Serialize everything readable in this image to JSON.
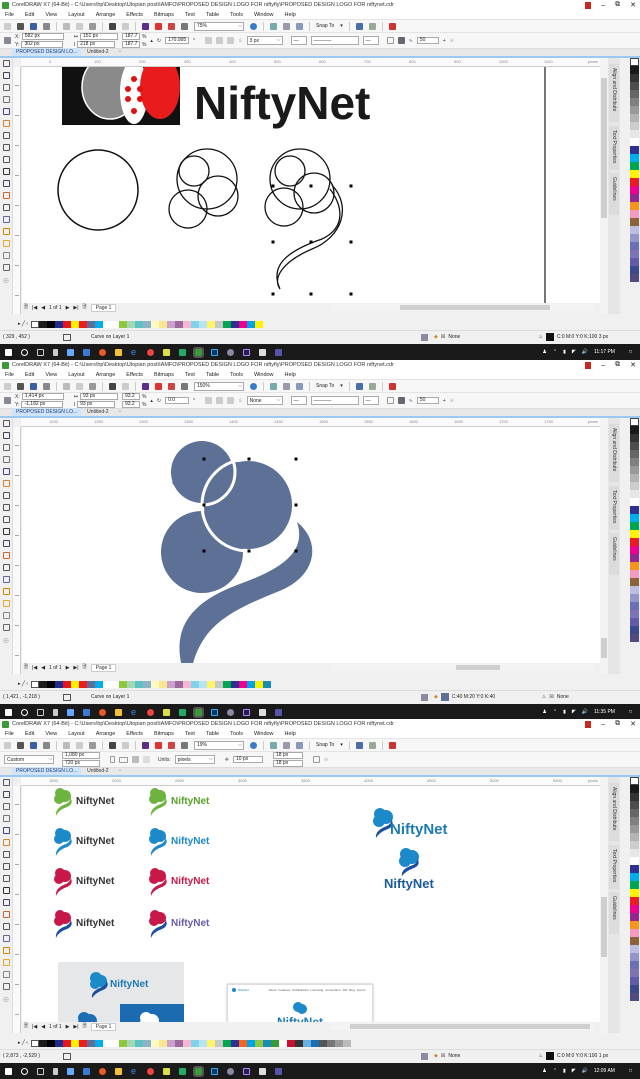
{
  "window": {
    "title": "CorelDRAW X7 (64-Bit) - C:\\Users\\hp\\Desktop\\Utopian post\\IAMFO\\PROPOSED DESIGN LOGO FOR niftyfly\\PROPOSED DESIGN LOGO FOR niftynet.cdr"
  },
  "menu": [
    "File",
    "Edit",
    "View",
    "Layout",
    "Arrange",
    "Effects",
    "Bitmaps",
    "Text",
    "Table",
    "Tools",
    "Window",
    "Help"
  ],
  "tabs": [
    {
      "label": "PROPOSED DESIGN LO..."
    },
    {
      "label": "Untitled-2"
    },
    {
      "label": "+"
    }
  ],
  "snap_label": "Snap To",
  "ruler_units": "pixels",
  "page_nav": {
    "counter": "1 of 1",
    "page_tab": "Page 1"
  },
  "palette_colors": [
    "#1a1a1a",
    "#333333",
    "#4d4d4d",
    "#666666",
    "#808080",
    "#999999",
    "#b3b3b3",
    "#cccccc",
    "#e6e6e6",
    "#ffffff",
    "#2e3192",
    "#00aeef",
    "#00a651",
    "#fff200",
    "#ed1c24",
    "#ec008c",
    "#92278f",
    "#f7941d",
    "#f49ac1",
    "#8c6239",
    "#bcbde0",
    "#9595c9",
    "#6d6fb5",
    "#7d73b5",
    "#605ca8",
    "#3a4a8a",
    "#514c80"
  ],
  "doc_palette": {
    "screen1": [
      "#1a1a1a",
      "#000000",
      "#1d2c8f",
      "#e8141e",
      "#fff200",
      "#ed1c24",
      "#5d7095",
      "#00aeef",
      "#ffffff",
      "#ffffff",
      "#8dc63f",
      "#a4d6b5",
      "#5bc4c1",
      "#8eb3c8",
      "#fff9c4",
      "#fbe58e",
      "#c7a0cb",
      "#9e6a9e",
      "#f7b6d2",
      "#7fd3e8",
      "#b8e3f4",
      "#fff568",
      "#c8c8c8",
      "#00a651",
      "#2e3192",
      "#ec008c",
      "#00a2e8",
      "#fff200"
    ],
    "screen2": [
      "#1a1a1a",
      "#000000",
      "#1d2c8f",
      "#e8141e",
      "#fff200",
      "#ed1c24",
      "#5d7095",
      "#00aeef",
      "#ffffff",
      "#ffffff",
      "#8dc63f",
      "#a4d6b5",
      "#5bc4c1",
      "#8eb3c8",
      "#fff9c4",
      "#fbe58e",
      "#c7a0cb",
      "#9e6a9e",
      "#f7b6d2",
      "#7fd3e8",
      "#b8e3f4",
      "#fff568",
      "#c8c8c8",
      "#00a651",
      "#2e3192",
      "#ec008c",
      "#00a2e8",
      "#fff200",
      "#1b8bb5"
    ],
    "screen3": [
      "#1a1a1a",
      "#000000",
      "#1d2c8f",
      "#e8141e",
      "#fff200",
      "#ed1c24",
      "#5d7095",
      "#00aeef",
      "#ffffff",
      "#ffffff",
      "#8dc63f",
      "#a4d6b5",
      "#5bc4c1",
      "#8eb3c8",
      "#fff9c4",
      "#fbe58e",
      "#c7a0cb",
      "#9e6a9e",
      "#f7b6d2",
      "#7fd3e8",
      "#b8e3f4",
      "#fff568",
      "#c8c8c8",
      "#00a651",
      "#2e3192",
      "#f26522",
      "#00a2e8",
      "#8dc63f",
      "#1b8bb5",
      "#3a9a3a",
      "#ffffff",
      "#c8102e",
      "#333333",
      "#6ab0de",
      "#1b6fb5",
      "#555555",
      "#777777",
      "#999999",
      "#bbbbbb"
    ]
  },
  "dockers": [
    "Align and Distribute",
    "Text Properties",
    "Guidelines"
  ],
  "screens": [
    {
      "zoom": "75%",
      "x": "582 px",
      "y": "302 px",
      "w": "151 px",
      "h": "218 px",
      "sx": "187.7",
      "sy": "187.7",
      "pct": "%",
      "angle": "170.995",
      "outline_width": "3 px",
      "smooth": "50",
      "ruler_ticks": [
        "0",
        "100",
        "200",
        "300",
        "400",
        "500",
        "600",
        "700",
        "800",
        "900",
        "1000",
        "1100"
      ],
      "status_coords": "( 329 , 452 )",
      "status_object": "Curve on Layer 1",
      "fill_label": "None",
      "outline_label": "C:0 M:0 Y:0 K:100  3 px",
      "clock": "11:17 PM",
      "canvas": {
        "logo_text": "NiftyNet"
      }
    },
    {
      "zoom": "150%",
      "x": "1,414 px",
      "y": "-1,182 px",
      "w": "93 px",
      "h": "93 px",
      "sx": "93.2",
      "sy": "93.2",
      "pct": "%",
      "angle": "0.0",
      "outline_width": "None",
      "smooth": "50",
      "ruler_ticks": [
        "1200",
        "1250",
        "1300",
        "1350",
        "1400",
        "1450",
        "1500",
        "1550",
        "1600",
        "1650",
        "1700",
        "1750"
      ],
      "status_coords": "( 1,421 , -1,218 )",
      "status_object": "Curve on Layer 1",
      "fill_label": "C:40 M:20 Y:0 K:40",
      "fill_color": "#5d7095",
      "outline_label": "None",
      "clock": "11:35 PM"
    },
    {
      "zoom": "19%",
      "preset": "Custom",
      "page_w": "1,080 px",
      "page_h": "720 px",
      "units_label": "Units:",
      "units": "pixels",
      "nudge": "10 px",
      "dup_x": "18 px",
      "dup_y": "18 px",
      "ruler_ticks": [
        "1500",
        "2000",
        "2500",
        "3000",
        "3500",
        "4000",
        "4500",
        "5000",
        "5500"
      ],
      "status_coords": "( 2,873 , -2,529 )",
      "fill_label": "None",
      "outline_label": "C:0 M:0 Y:0 K:100  1 px",
      "clock": "12:09 AM",
      "logos": [
        {
          "text": "NiftyNet",
          "mark": "#6cb33f",
          "text_color": "#333333"
        },
        {
          "text": "NiftyNet",
          "mark": "#6cb33f",
          "text_color": "#5aa02c"
        },
        {
          "text": "NiftyNet",
          "mark": "#1c8ac9",
          "text_color": "#333333"
        },
        {
          "text": "NiftyNet",
          "mark": "#1c8ac9",
          "text_color": "#1c8ac9"
        },
        {
          "text": "NiftyNet",
          "mark": "#c8184a",
          "text_color": "#333333"
        },
        {
          "text": "NiftyNet",
          "mark": "#c8184a",
          "text_color": "#c8184a"
        },
        {
          "text": "NiftyNet",
          "mark": "#c8184a",
          "text_color": "#333333"
        },
        {
          "text": "NiftyNet",
          "mark": "#c8184a",
          "text_color": "#6a5aa8"
        }
      ],
      "big_logo_text": "NiftyNet",
      "stacked_logo_text": "NiftyNet",
      "card_logo_text": "NiftyNet",
      "web_mock": {
        "brand": "NiftyNet",
        "nav": [
          "About",
          "Features",
          "Publications",
          "Licensing",
          "Consortium",
          "API",
          "Bug",
          "Forum"
        ],
        "hero": "NiftyNet"
      }
    }
  ]
}
